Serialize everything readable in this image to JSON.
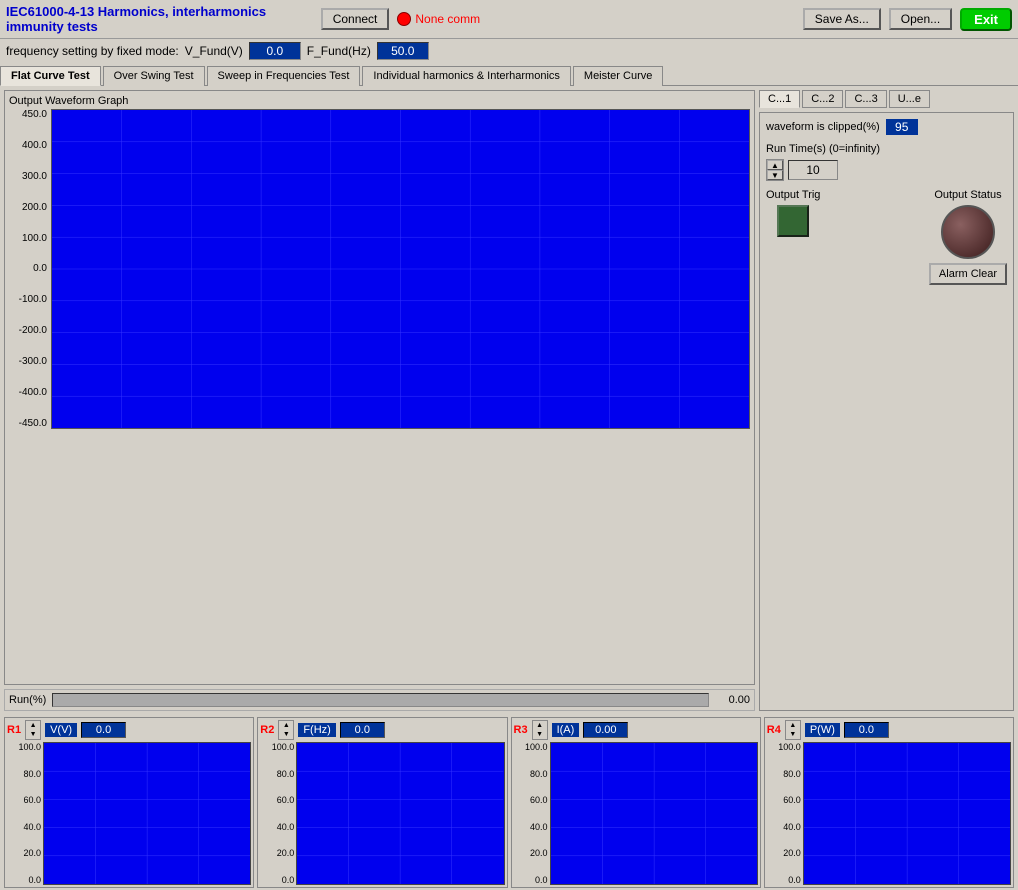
{
  "header": {
    "title": "IEC61000-4-13 Harmonics, interharmonics immunity tests",
    "connect_label": "Connect",
    "status_text": "None comm",
    "save_label": "Save As...",
    "open_label": "Open...",
    "exit_label": "Exit"
  },
  "freq_row": {
    "label": "frequency setting by fixed mode:",
    "v_fund_label": "V_Fund(V)",
    "v_fund_value": "0.0",
    "f_fund_label": "F_Fund(Hz)",
    "f_fund_value": "50.0"
  },
  "tabs": {
    "items": [
      {
        "label": "Flat Curve Test",
        "active": true
      },
      {
        "label": "Over Swing Test",
        "active": false
      },
      {
        "label": "Sweep in Frequencies Test",
        "active": false
      },
      {
        "label": "Individual harmonics & Interharmonics",
        "active": false
      },
      {
        "label": "Meister Curve",
        "active": false
      }
    ]
  },
  "waveform": {
    "label": "Output Waveform Graph",
    "y_axis": [
      "450.0",
      "400.0",
      "300.0",
      "200.0",
      "100.0",
      "0.0",
      "-100.0",
      "-200.0",
      "-300.0",
      "-400.0",
      "-450.0"
    ]
  },
  "run_bar": {
    "label": "Run(%)",
    "value": "0.00"
  },
  "right_panel": {
    "channel_tabs": [
      "C...1",
      "C...2",
      "C...3",
      "U...e"
    ],
    "clip_label": "waveform is clipped(%)",
    "clip_value": "95",
    "run_time_label": "Run Time(s) (0=infinity)",
    "run_time_value": "10",
    "output_trig_label": "Output Trig",
    "output_status_label": "Output Status",
    "alarm_clear_label": "Alarm Clear"
  },
  "meters": [
    {
      "id": "R1",
      "unit": "V(V)",
      "value": "0.0",
      "y_axis": [
        "100.0",
        "80.0",
        "60.0",
        "40.0",
        "20.0",
        "0.0"
      ]
    },
    {
      "id": "R2",
      "unit": "F(Hz)",
      "value": "0.0",
      "y_axis": [
        "100.0",
        "80.0",
        "60.0",
        "40.0",
        "20.0",
        "0.0"
      ]
    },
    {
      "id": "R3",
      "unit": "I(A)",
      "value": "0.00",
      "y_axis": [
        "100.0",
        "80.0",
        "60.0",
        "40.0",
        "20.0",
        "0.0"
      ]
    },
    {
      "id": "R4",
      "unit": "P(W)",
      "value": "0.0",
      "y_axis": [
        "100.0",
        "80.0",
        "60.0",
        "40.0",
        "20.0",
        "0.0"
      ]
    }
  ]
}
